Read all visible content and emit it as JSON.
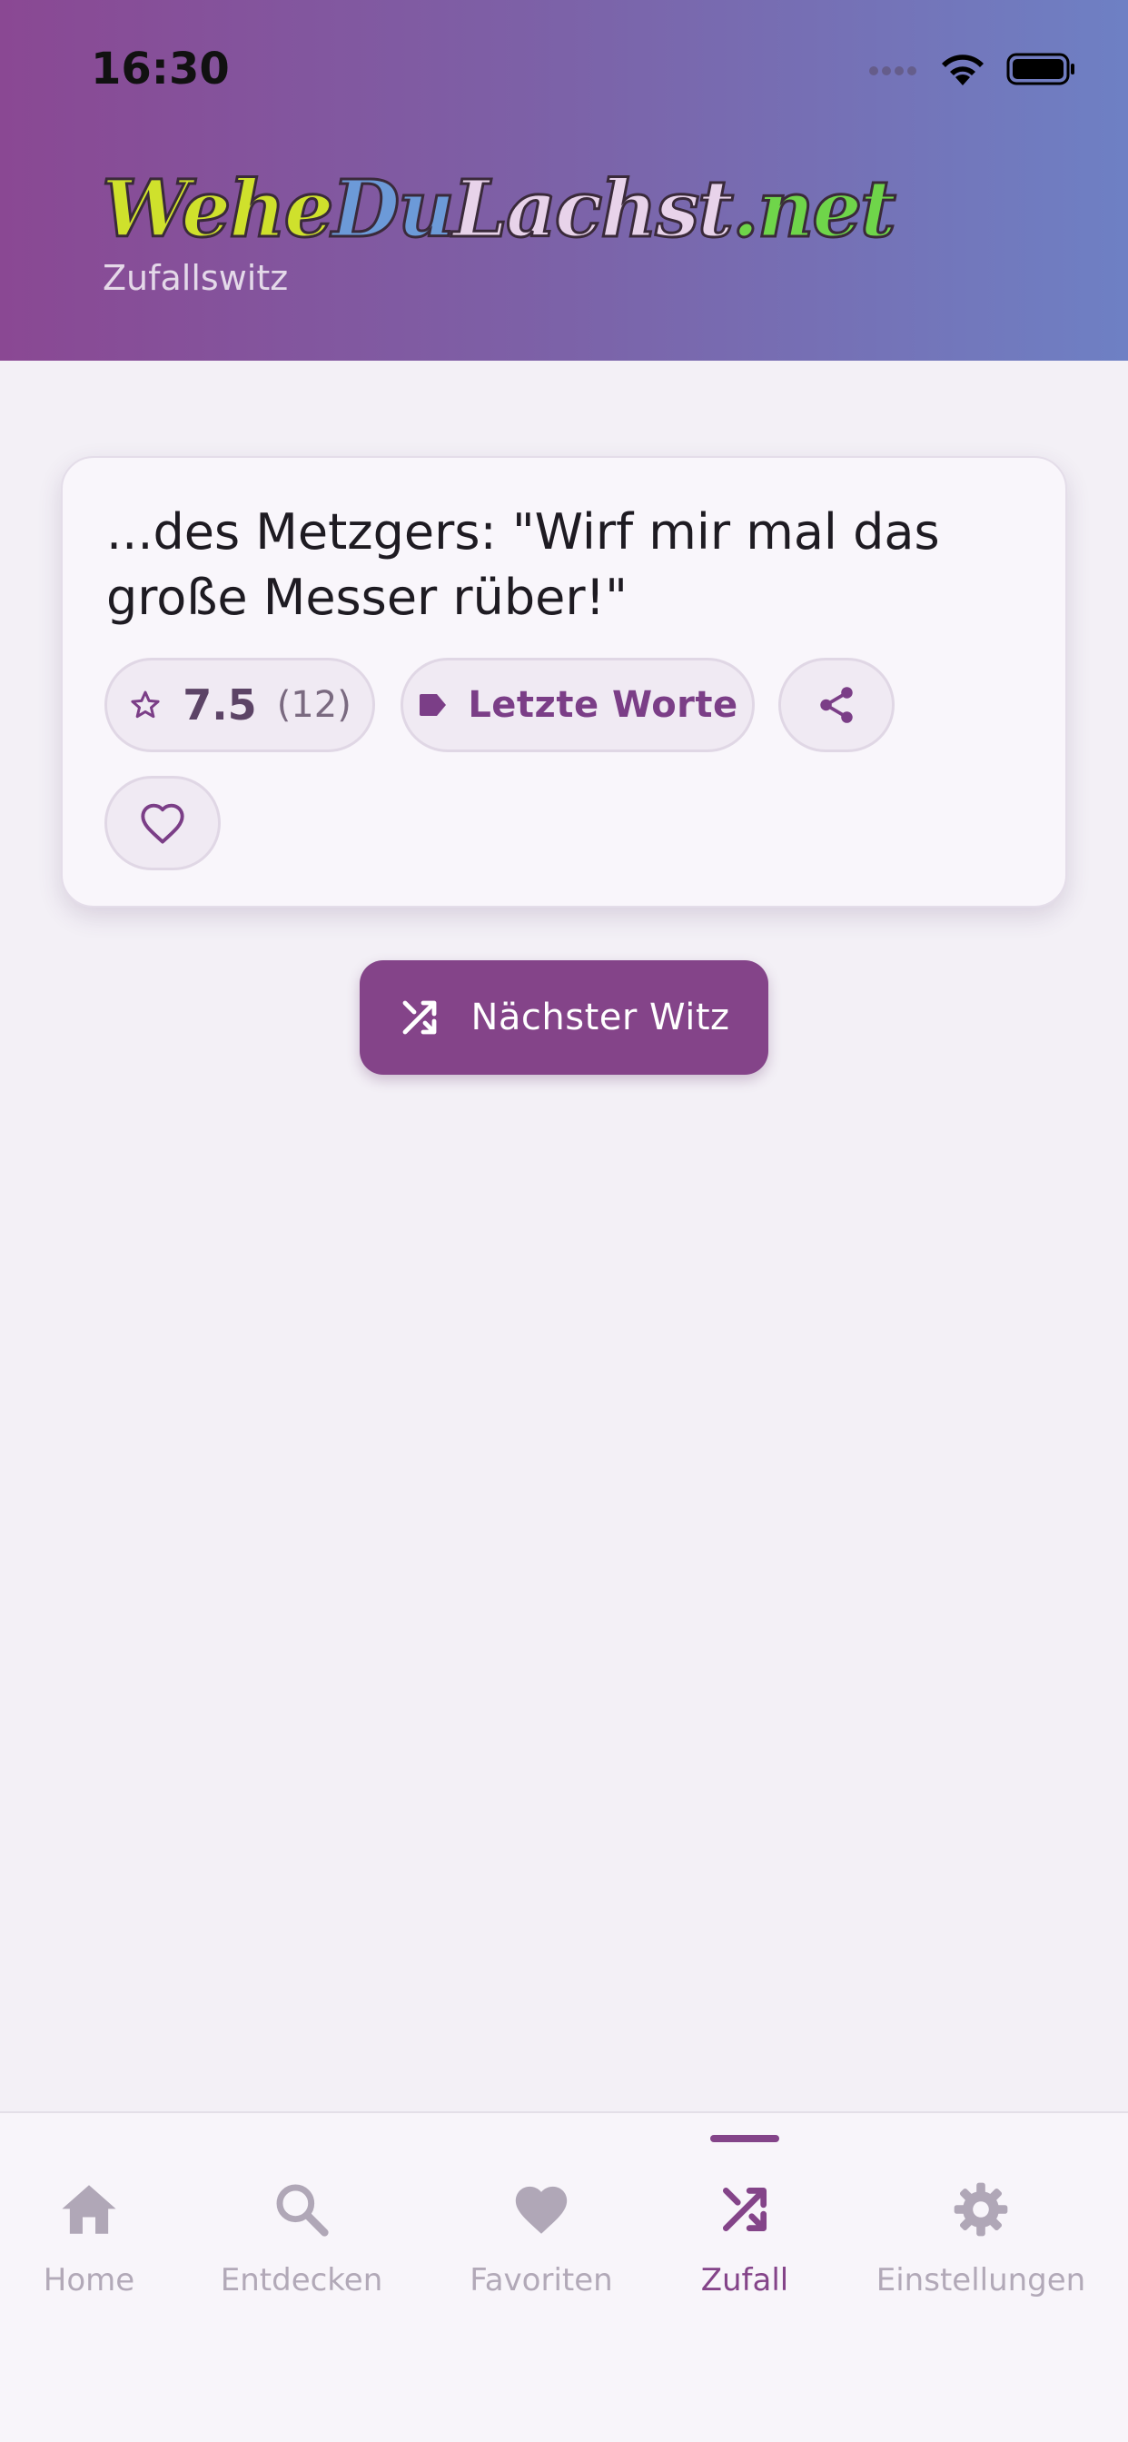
{
  "status_bar": {
    "time": "16:30"
  },
  "header": {
    "logo_parts": [
      "Wehe",
      "Du",
      "Lachst",
      ".net"
    ],
    "subtitle": "Zufallswitz"
  },
  "joke": {
    "text": "...des Metzgers: \"Wirf mir mal das große Messer rüber!\"",
    "rating": "7.5",
    "rating_count": "(12)",
    "category": "Letzte Worte"
  },
  "actions": {
    "next_label": "Nächster Witz"
  },
  "nav": {
    "items": [
      {
        "label": "Home",
        "icon": "home-icon"
      },
      {
        "label": "Entdecken",
        "icon": "search-icon"
      },
      {
        "label": "Favoriten",
        "icon": "heart-icon"
      },
      {
        "label": "Zufall",
        "icon": "shuffle-icon"
      },
      {
        "label": "Einstellungen",
        "icon": "gear-icon"
      }
    ],
    "active": "Zufall"
  },
  "colors": {
    "primary": "#844489",
    "header_gradient_start": "#8a4893",
    "header_gradient_end": "#6e80c4",
    "background": "#f3f0f6",
    "nav_inactive": "#b2a9b8"
  }
}
